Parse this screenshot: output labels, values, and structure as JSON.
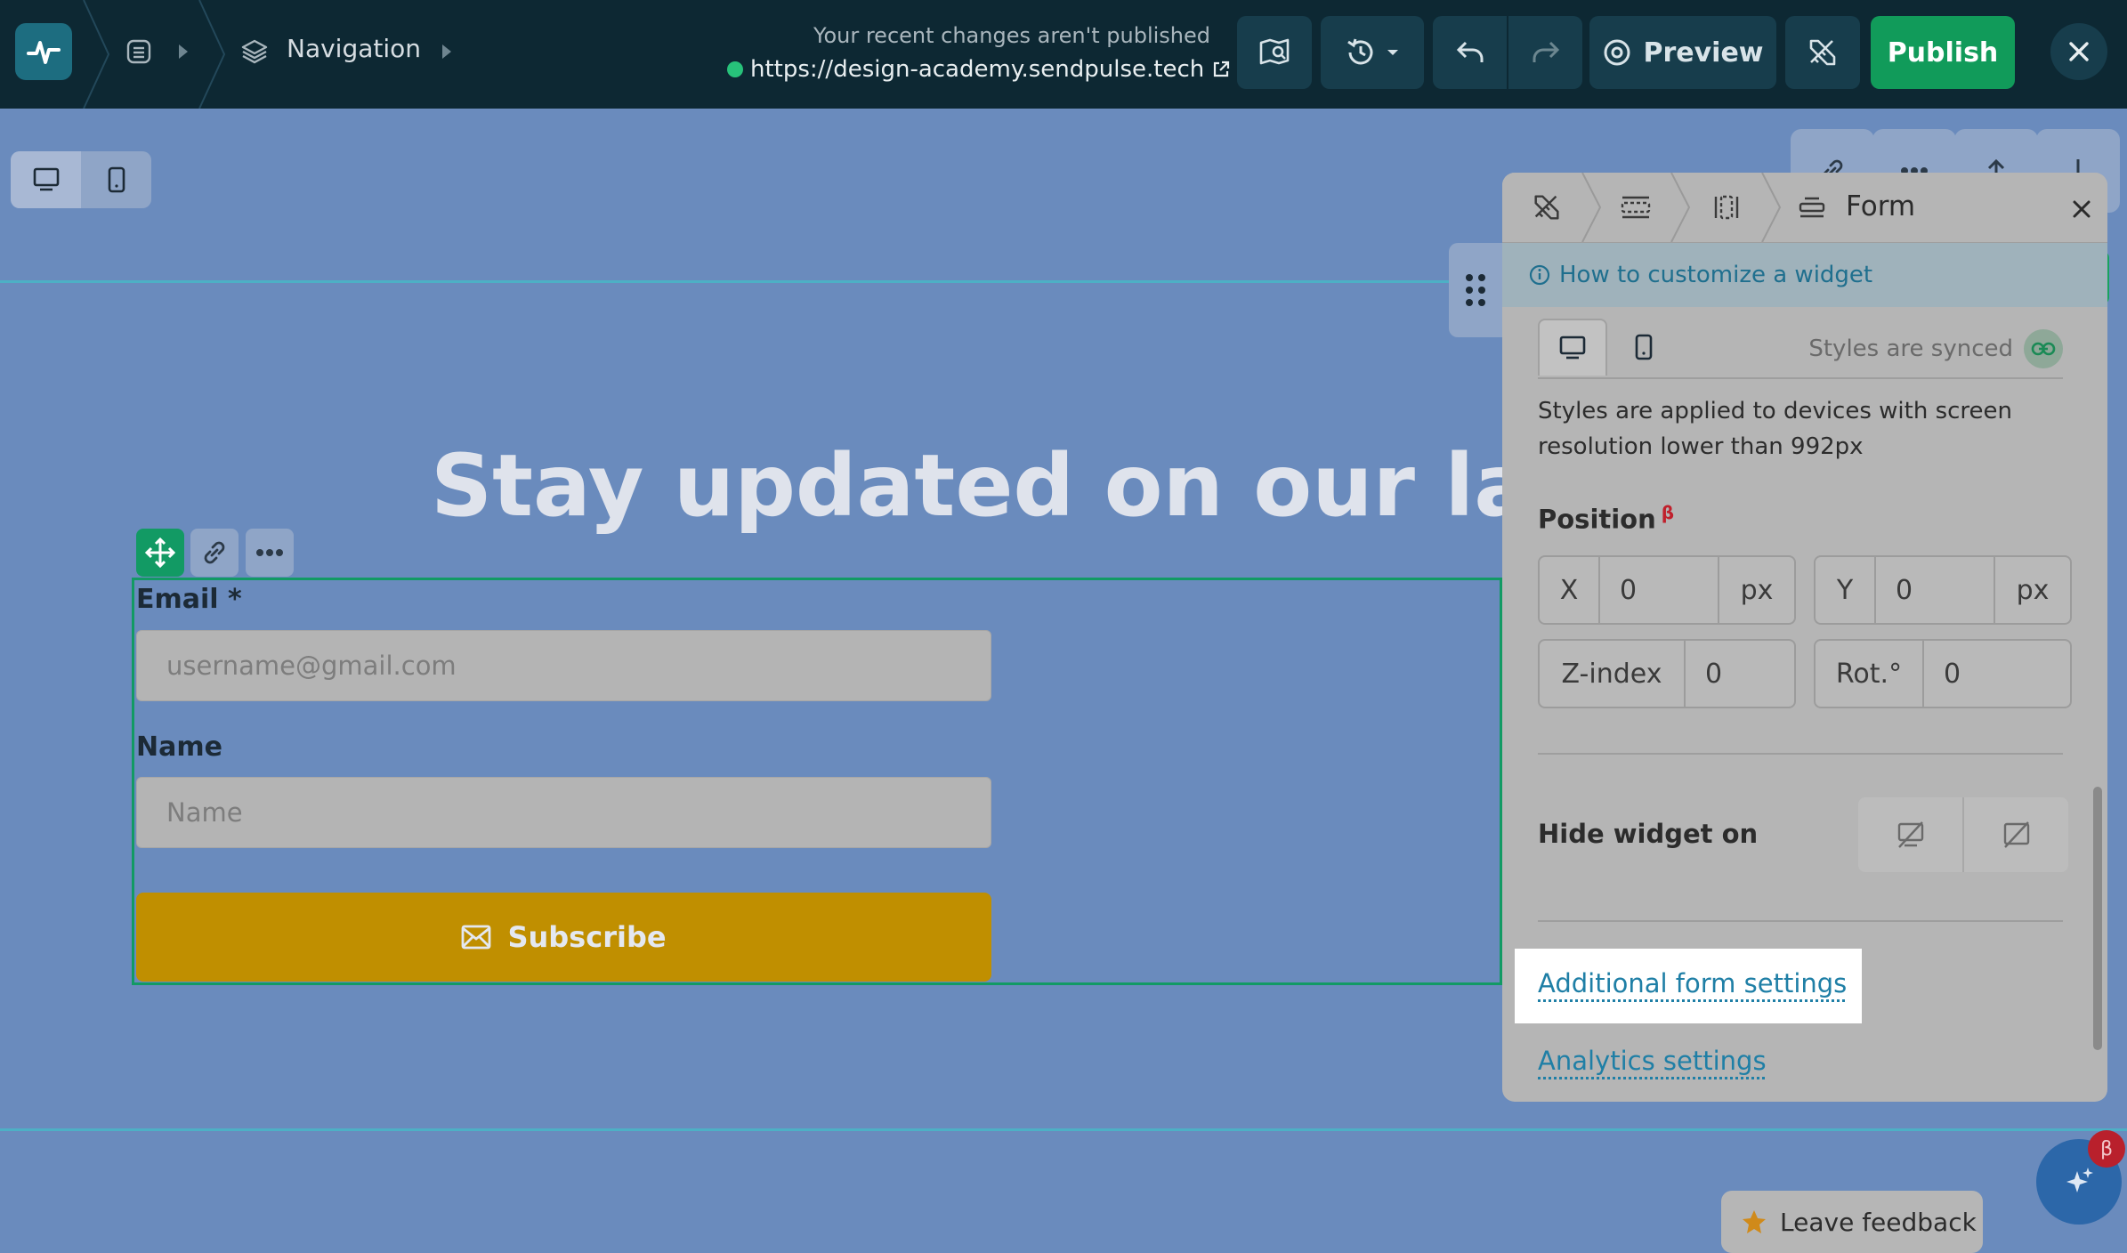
{
  "topbar": {
    "breadcrumb_label": "Navigation",
    "unpublished_notice": "Your recent changes aren't published",
    "site_url": "https://design-academy.sendpulse.tech",
    "preview_label": "Preview",
    "publish_label": "Publish"
  },
  "canvas": {
    "heading": "Stay updated on our last n",
    "form": {
      "email_label": "Email *",
      "email_placeholder": "username@gmail.com",
      "name_label": "Name",
      "name_placeholder": "Name",
      "subscribe_label": "Subscribe"
    }
  },
  "panel": {
    "title": "Form",
    "help_link": "How to customize a widget",
    "styles_synced": "Styles are synced",
    "description": "Styles are applied to devices with screen resolution lower than 992px",
    "position_title": "Position",
    "beta_mark": "β",
    "x_label": "X",
    "x_value": "0",
    "x_unit": "px",
    "y_label": "Y",
    "y_value": "0",
    "y_unit": "px",
    "z_label": "Z-index",
    "z_value": "0",
    "rot_label": "Rot.°",
    "rot_value": "0",
    "hide_title": "Hide widget on",
    "additional_settings": "Additional form settings",
    "analytics_settings": "Analytics settings"
  },
  "footer": {
    "feedback_label": "Leave feedback",
    "ai_badge": "β"
  },
  "colors": {
    "topbar_bg": "#0d2833",
    "publish_green": "#119b5a",
    "canvas_bg": "#6a8bbd",
    "subscribe_bg": "#c08f00",
    "link_blue": "#1f7fa6"
  }
}
